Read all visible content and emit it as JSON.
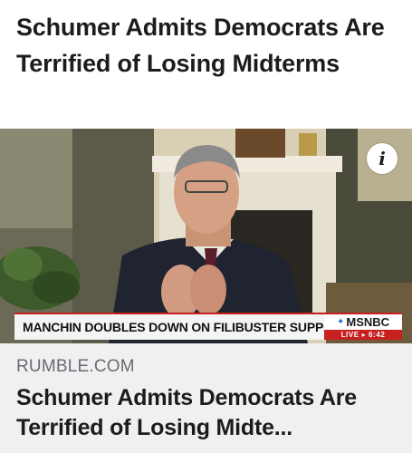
{
  "post": {
    "text": "Schumer Admits Democrats Are Terrified of Losing Midterms"
  },
  "video": {
    "info_icon": "i",
    "chyron": {
      "headline": "MANCHIN DOUBLES DOWN ON FILIBUSTER SUPPORT",
      "network": "MSNBC",
      "live_label": "LIVE ▸ 6:42"
    }
  },
  "link_preview": {
    "source": "RUMBLE.COM",
    "title": "Schumer Admits Democrats Are Terrified of Losing Midte..."
  },
  "colors": {
    "chyron_red": "#c81f1f",
    "footer_bg": "#f0f0f2",
    "source_gray": "#6b6b6f"
  }
}
